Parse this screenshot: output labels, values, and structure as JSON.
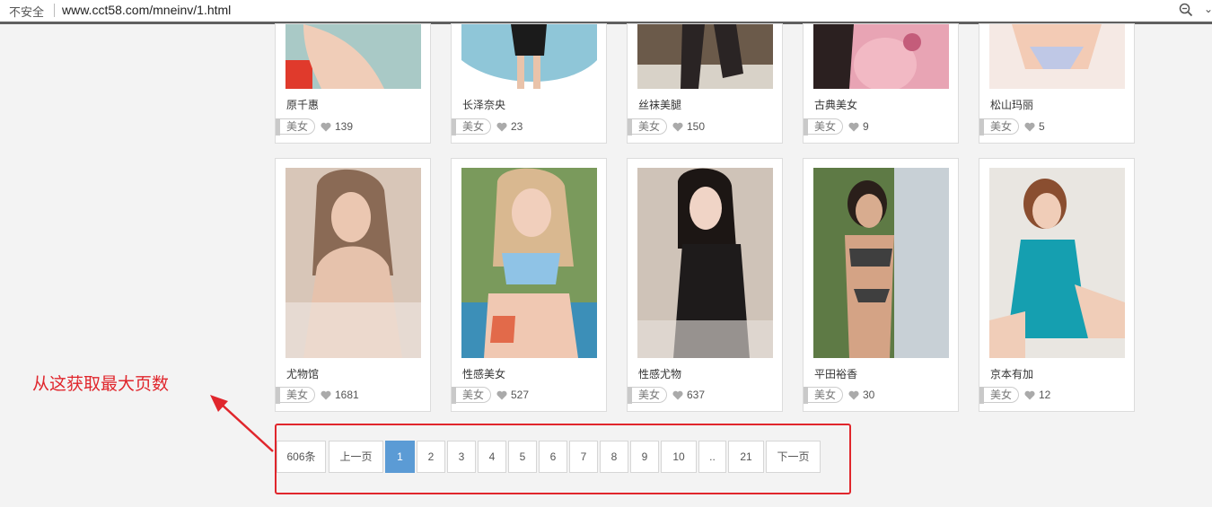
{
  "browser": {
    "security_label": "不安全",
    "url": "www.cct58.com/mneinv/1.html"
  },
  "cards_top": [
    {
      "title": "原千惠",
      "tag": "美女",
      "likes": "139"
    },
    {
      "title": "长泽奈央",
      "tag": "美女",
      "likes": "23"
    },
    {
      "title": "丝袜美腿",
      "tag": "美女",
      "likes": "150"
    },
    {
      "title": "古典美女",
      "tag": "美女",
      "likes": "9"
    },
    {
      "title": "松山玛丽",
      "tag": "美女",
      "likes": "5"
    }
  ],
  "cards_bottom": [
    {
      "title": "尤物馆",
      "tag": "美女",
      "likes": "1681"
    },
    {
      "title": "性感美女",
      "tag": "美女",
      "likes": "527"
    },
    {
      "title": "性感尤物",
      "tag": "美女",
      "likes": "637"
    },
    {
      "title": "平田裕香",
      "tag": "美女",
      "likes": "30"
    },
    {
      "title": "京本有加",
      "tag": "美女",
      "likes": "12"
    }
  ],
  "annotation": {
    "text": "从这获取最大页数",
    "color": "#e0262c"
  },
  "pagination": {
    "total": "606条",
    "prev": "上一页",
    "pages": [
      "1",
      "2",
      "3",
      "4",
      "5",
      "6",
      "7",
      "8",
      "9",
      "10"
    ],
    "current": "1",
    "ellipsis": "..",
    "last": "21",
    "next": "下一页"
  },
  "colors": {
    "accent": "#5b9bd5",
    "background": "#f3f3f3",
    "annotation_red": "#e0262c"
  },
  "icons": [
    "zoom-icon",
    "heart-icon",
    "more-icon"
  ]
}
